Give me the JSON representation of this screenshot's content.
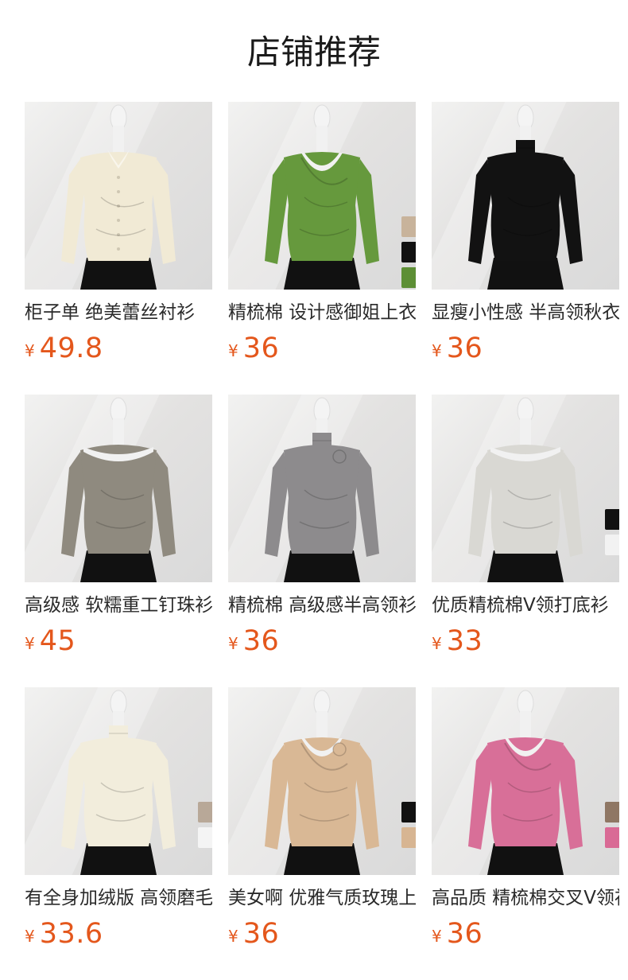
{
  "title": "店铺推荐",
  "products": [
    {
      "name": "柜子单 绝美蕾丝衬衫",
      "currency": "¥",
      "price": "49.8",
      "garment_color": "#f1ead5",
      "neck": "collar",
      "swatches": []
    },
    {
      "name": "精梳棉 设计感御姐上衣",
      "currency": "¥",
      "price": "36",
      "garment_color": "#66993d",
      "neck": "twist",
      "swatches": [
        "#c8b39b",
        "#111111",
        "#5d8f35"
      ]
    },
    {
      "name": "显瘦小性感 半高领秋衣",
      "currency": "¥",
      "price": "36",
      "garment_color": "#121212",
      "neck": "mock",
      "swatches": []
    },
    {
      "name": "高级感 软糯重工钉珠衫",
      "currency": "¥",
      "price": "45",
      "garment_color": "#8f8a7f",
      "neck": "offshoulder",
      "swatches": []
    },
    {
      "name": "精梳棉 高级感半高领衫",
      "currency": "¥",
      "price": "36",
      "garment_color": "#8d8b8d",
      "neck": "mock",
      "swatches": []
    },
    {
      "name": "优质精梳棉V领打底衫",
      "currency": "¥",
      "price": "33",
      "garment_color": "#d9d8d3",
      "neck": "scoop",
      "swatches": [
        "#111111",
        "#f2f2f2"
      ]
    },
    {
      "name": "有全身加绒版 高领磨毛",
      "currency": "¥",
      "price": "33.6",
      "garment_color": "#f2eddc",
      "neck": "high",
      "swatches": [
        "#b8a898",
        "#f4f4f4"
      ]
    },
    {
      "name": "美女啊 优雅气质玫瑰上衣",
      "currency": "¥",
      "price": "36",
      "garment_color": "#d9b895",
      "neck": "v",
      "swatches": [
        "#111111",
        "#d7b592"
      ]
    },
    {
      "name": "高品质 精梳棉交叉V领衫",
      "currency": "¥",
      "price": "36",
      "garment_color": "#d86f98",
      "neck": "wrap",
      "swatches": [
        "#8f7764",
        "#d96a95"
      ]
    }
  ]
}
